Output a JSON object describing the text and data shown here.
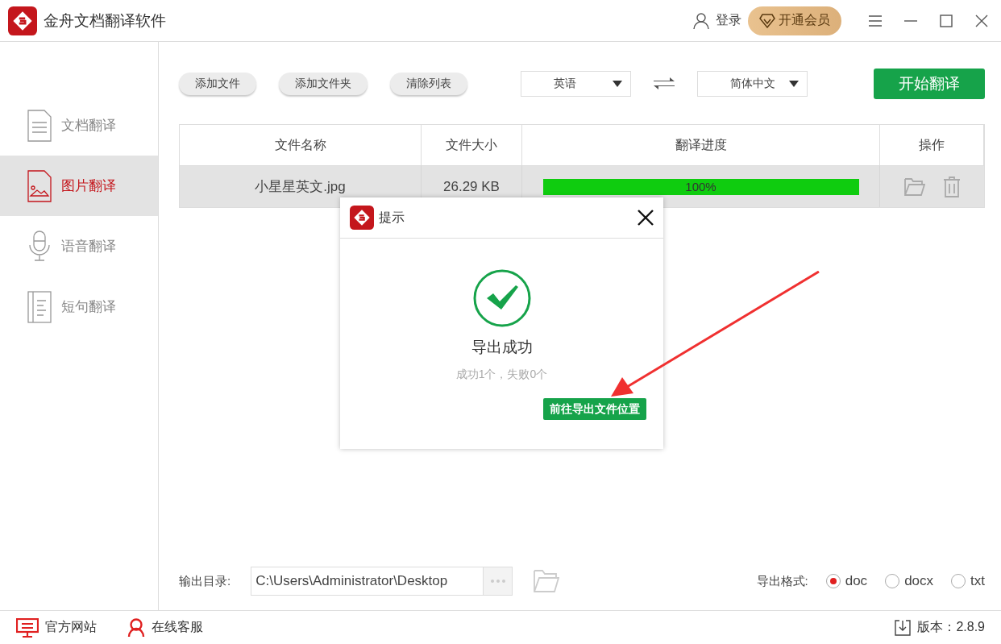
{
  "window": {
    "title": "金舟文档翻译软件",
    "login": "登录",
    "vip": "开通会员"
  },
  "sidebar": {
    "items": [
      {
        "kind": "document",
        "label": "文档翻译",
        "selected": false
      },
      {
        "kind": "image",
        "label": "图片翻译",
        "selected": true
      },
      {
        "kind": "voice",
        "label": "语音翻译",
        "selected": false
      },
      {
        "kind": "sentence",
        "label": "短句翻译",
        "selected": false
      }
    ]
  },
  "toolbar": {
    "buttons": [
      "添加文件",
      "添加文件夹",
      "清除列表"
    ],
    "source_language": "英语",
    "target_language": "简体中文",
    "start": "开始翻译"
  },
  "table": {
    "columns": [
      "文件名称",
      "文件大小",
      "翻译进度",
      "操作"
    ],
    "rows": [
      {
        "name": "小星星英文.jpg",
        "size": "26.29 KB",
        "progress": {
          "level": 1,
          "reading": "100%"
        }
      }
    ]
  },
  "dialog": {
    "title": "提示",
    "heading": "导出成功",
    "summary": "成功1个，失败0个",
    "action": "前往导出文件位置"
  },
  "output": {
    "label": "输出目录:",
    "path": "C:\\Users\\Administrator\\Desktop",
    "format_label": "导出格式:",
    "formats": [
      {
        "label": "doc",
        "selected": true
      },
      {
        "label": "docx",
        "selected": false
      },
      {
        "label": "txt",
        "selected": false
      }
    ]
  },
  "status_bar": {
    "website": "官方网站",
    "support": "在线客服",
    "version": "版本：2.8.9"
  }
}
